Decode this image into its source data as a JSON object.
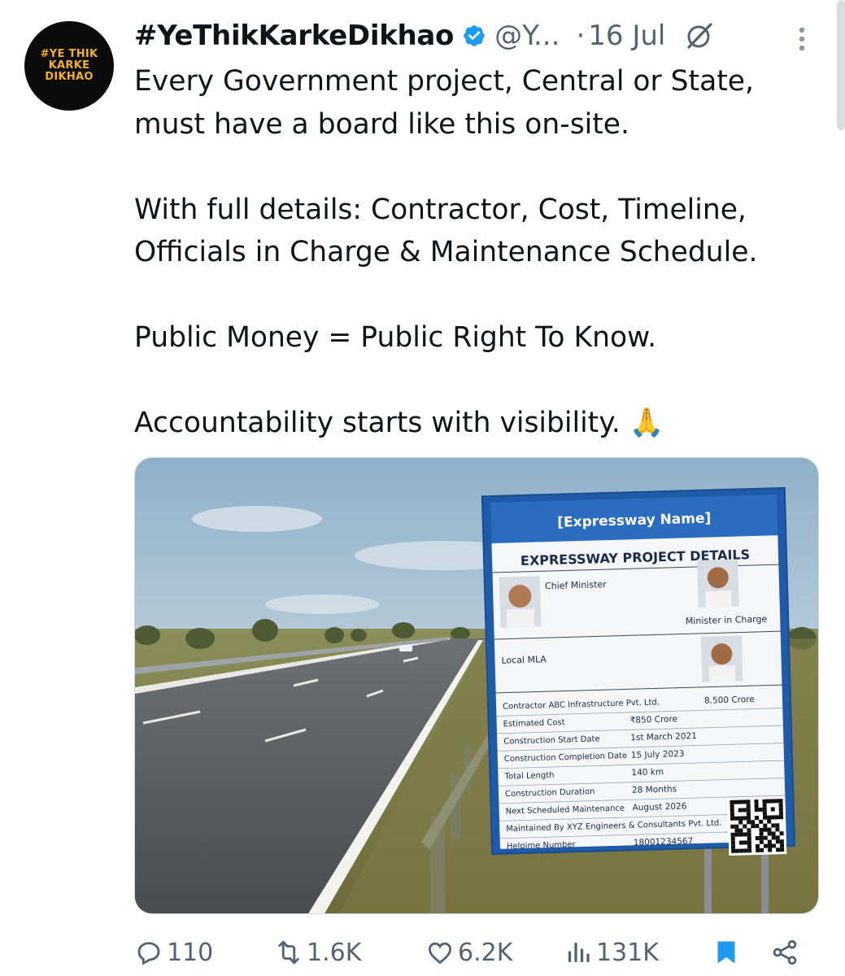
{
  "tweet": {
    "avatar_lines": [
      "#YE THIK",
      "KARKE",
      "DIKHAO"
    ],
    "display_name": "#YeThikKarkeDikhao",
    "handle": "@Y...",
    "separator": "·",
    "date": "16 Jul",
    "text_lines": [
      "Every Government project, Central or State,",
      "must have a board like this on-site.",
      "With full details: Contractor, Cost, Timeline,",
      "Officials in Charge & Maintenance Schedule.",
      "Public Money = Public Right To Know.",
      "Accountability starts with visibility. 🙏"
    ]
  },
  "board": {
    "title": "[Expressway Name]",
    "subtitle": "EXPRESSWAY PROJECT DETAILS",
    "chief_minister": "Chief Minister",
    "minister_in_charge": "Minister in Charge",
    "local_mla": "Local MLA",
    "rows": [
      {
        "label": "Contractor  ABC Infrastructure Pvt. Ltd.",
        "value": "8.500 Crore"
      },
      {
        "label": "Estimated Cost",
        "value": "₹850 Crore"
      },
      {
        "label": "Construction Start Date",
        "value": "1st March 2021"
      },
      {
        "label": "Construction Completion Date",
        "value": "15 July 2023"
      },
      {
        "label": "Total Length",
        "value": "140 km"
      },
      {
        "label": "Construction Duration",
        "value": "28 Months"
      },
      {
        "label": "Next Scheduled Maintenance",
        "value": "August 2026"
      },
      {
        "label": "Maintained By XYZ Engineers & Consultants Pvt. Ltd.",
        "value": ""
      },
      {
        "label": "Helpime Number",
        "value": "18001234567"
      }
    ]
  },
  "actions": {
    "replies": "110",
    "reposts": "1.6K",
    "likes": "6.2K",
    "views": "131K"
  },
  "colors": {
    "text": "#0f1419",
    "muted": "#536471",
    "verified": "#1d9bf0",
    "bookmark": "#1d9bf0",
    "avatar_text": "#f5b120",
    "board_blue": "#1f5ba8"
  },
  "icons": [
    "verified-badge-icon",
    "grok-icon",
    "more-vertical-icon",
    "reply-icon",
    "repost-icon",
    "like-icon",
    "views-icon",
    "bookmark-icon",
    "share-icon",
    "prayer-hands-icon"
  ]
}
